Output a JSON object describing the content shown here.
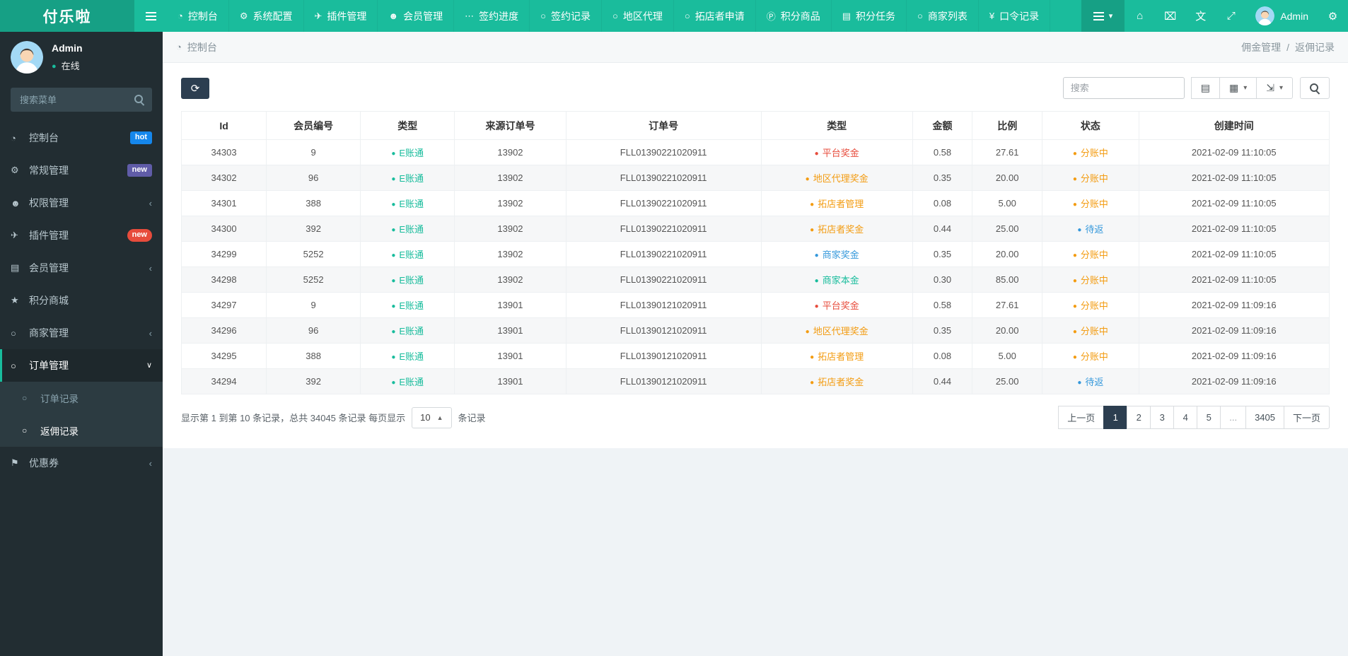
{
  "navbar": {
    "brand": "付乐啦",
    "menu": [
      {
        "label": "控制台",
        "icon": "dashboard-icon",
        "glyph": "◔"
      },
      {
        "label": "系统配置",
        "icon": "gear-icon",
        "glyph": "⚙"
      },
      {
        "label": "插件管理",
        "icon": "paper-plane-icon",
        "glyph": "✈"
      },
      {
        "label": "会员管理",
        "icon": "user-icon",
        "glyph": "☻"
      },
      {
        "label": "签约进度",
        "icon": "ellipsis-icon",
        "glyph": "⋯"
      },
      {
        "label": "签约记录",
        "icon": "circle-o-icon",
        "glyph": "○"
      },
      {
        "label": "地区代理",
        "icon": "circle-o-icon",
        "glyph": "○"
      },
      {
        "label": "拓店者申请",
        "icon": "circle-o-icon",
        "glyph": "○"
      },
      {
        "label": "积分商品",
        "icon": "circled-p-icon",
        "glyph": "Ⓟ"
      },
      {
        "label": "积分任务",
        "icon": "list-icon",
        "glyph": "▤"
      },
      {
        "label": "商家列表",
        "icon": "circle-o-icon",
        "glyph": "○"
      },
      {
        "label": "口令记录",
        "icon": "yen-icon",
        "glyph": "¥"
      }
    ],
    "more_caret": "▾",
    "right_icons": [
      {
        "name": "home-button",
        "icon": "home-icon",
        "glyph": "⌂"
      },
      {
        "name": "clear-cache-button",
        "icon": "trash-icon",
        "glyph": "⌧"
      },
      {
        "name": "language-button",
        "icon": "language-icon",
        "glyph": "文"
      },
      {
        "name": "fullscreen-button",
        "icon": "fullscreen-icon",
        "glyph": "⤢"
      }
    ],
    "user_name": "Admin",
    "settings_glyph": "⚙"
  },
  "sidebar": {
    "user_name": "Admin",
    "user_status": "在线",
    "search_placeholder": "搜索菜单",
    "items": [
      {
        "label": "控制台",
        "icon": "dashboard-icon",
        "glyph": "◔",
        "badge": "hot",
        "badge_color": "#1587ec"
      },
      {
        "label": "常规管理",
        "icon": "cogs-icon",
        "glyph": "⚙",
        "badge": "new",
        "badge_color": "#605ca8"
      },
      {
        "label": "权限管理",
        "icon": "users-icon",
        "glyph": "☻",
        "chevron": "‹"
      },
      {
        "label": "插件管理",
        "icon": "paper-plane-icon",
        "glyph": "✈",
        "badge": "new",
        "badge_color": "#e74c3c",
        "badge_pill": "pill"
      },
      {
        "label": "会员管理",
        "icon": "list-icon",
        "glyph": "▤",
        "chevron": "‹"
      },
      {
        "label": "积分商城",
        "icon": "star-icon",
        "glyph": "★"
      },
      {
        "label": "商家管理",
        "icon": "circle-o-icon",
        "glyph": "○",
        "chevron": "‹"
      },
      {
        "label": "订单管理",
        "icon": "circle-o-icon",
        "glyph": "○",
        "chevron": "∨",
        "cls": "open"
      },
      {
        "label": "订单记录",
        "icon": "circle-o-icon",
        "glyph": "○",
        "cls": "sub"
      },
      {
        "label": "返佣记录",
        "icon": "circle-o-icon",
        "glyph": "○",
        "cls": "sub active"
      },
      {
        "label": "优惠券",
        "icon": "flag-icon",
        "glyph": "⚑",
        "chevron": "‹"
      }
    ]
  },
  "breadcrumb": {
    "location_glyph": "◔",
    "location": "控制台",
    "trail": [
      "佣金管理",
      "返佣记录"
    ],
    "separator": "/"
  },
  "toolbar": {
    "refresh_glyph": "⟳",
    "search_placeholder": "搜索",
    "buttons": [
      {
        "name": "detail-view-button",
        "icon": "detail-view-icon",
        "glyph": "▤"
      },
      {
        "name": "columns-dropdown-button",
        "icon": "columns-icon",
        "glyph": "▦",
        "caret": "▾"
      },
      {
        "name": "export-dropdown-button",
        "icon": "export-icon",
        "glyph": "⇲",
        "caret": "▾"
      }
    ]
  },
  "table": {
    "headers": [
      "Id",
      "会员编号",
      "类型",
      "来源订单号",
      "订单号",
      "类型",
      "金额",
      "比例",
      "状态",
      "创建时间"
    ],
    "rows": [
      {
        "id": "34303",
        "member_no": "9",
        "account_type": "E账通",
        "account_color": "#18bc9c",
        "source_order_no": "13902",
        "order_no": "FLL01390221020911",
        "reward_type": "平台奖金",
        "reward_color": "#e74c3c",
        "amount": "0.58",
        "ratio": "27.61",
        "status": "分账中",
        "status_color": "#f39c12",
        "created_at": "2021-02-09 11:10:05"
      },
      {
        "id": "34302",
        "member_no": "96",
        "account_type": "E账通",
        "account_color": "#18bc9c",
        "source_order_no": "13902",
        "order_no": "FLL01390221020911",
        "reward_type": "地区代理奖金",
        "reward_color": "#f39c12",
        "amount": "0.35",
        "ratio": "20.00",
        "status": "分账中",
        "status_color": "#f39c12",
        "created_at": "2021-02-09 11:10:05"
      },
      {
        "id": "34301",
        "member_no": "388",
        "account_type": "E账通",
        "account_color": "#18bc9c",
        "source_order_no": "13902",
        "order_no": "FLL01390221020911",
        "reward_type": "拓店者管理",
        "reward_color": "#f39c12",
        "amount": "0.08",
        "ratio": "5.00",
        "status": "分账中",
        "status_color": "#f39c12",
        "created_at": "2021-02-09 11:10:05"
      },
      {
        "id": "34300",
        "member_no": "392",
        "account_type": "E账通",
        "account_color": "#18bc9c",
        "source_order_no": "13902",
        "order_no": "FLL01390221020911",
        "reward_type": "拓店者奖金",
        "reward_color": "#f39c12",
        "amount": "0.44",
        "ratio": "25.00",
        "status": "待返",
        "status_color": "#3498db",
        "created_at": "2021-02-09 11:10:05"
      },
      {
        "id": "34299",
        "member_no": "5252",
        "account_type": "E账通",
        "account_color": "#18bc9c",
        "source_order_no": "13902",
        "order_no": "FLL01390221020911",
        "reward_type": "商家奖金",
        "reward_color": "#3498db",
        "amount": "0.35",
        "ratio": "20.00",
        "status": "分账中",
        "status_color": "#f39c12",
        "created_at": "2021-02-09 11:10:05"
      },
      {
        "id": "34298",
        "member_no": "5252",
        "account_type": "E账通",
        "account_color": "#18bc9c",
        "source_order_no": "13902",
        "order_no": "FLL01390221020911",
        "reward_type": "商家本金",
        "reward_color": "#18bc9c",
        "amount": "0.30",
        "ratio": "85.00",
        "status": "分账中",
        "status_color": "#f39c12",
        "created_at": "2021-02-09 11:10:05"
      },
      {
        "id": "34297",
        "member_no": "9",
        "account_type": "E账通",
        "account_color": "#18bc9c",
        "source_order_no": "13901",
        "order_no": "FLL01390121020911",
        "reward_type": "平台奖金",
        "reward_color": "#e74c3c",
        "amount": "0.58",
        "ratio": "27.61",
        "status": "分账中",
        "status_color": "#f39c12",
        "created_at": "2021-02-09 11:09:16"
      },
      {
        "id": "34296",
        "member_no": "96",
        "account_type": "E账通",
        "account_color": "#18bc9c",
        "source_order_no": "13901",
        "order_no": "FLL01390121020911",
        "reward_type": "地区代理奖金",
        "reward_color": "#f39c12",
        "amount": "0.35",
        "ratio": "20.00",
        "status": "分账中",
        "status_color": "#f39c12",
        "created_at": "2021-02-09 11:09:16"
      },
      {
        "id": "34295",
        "member_no": "388",
        "account_type": "E账通",
        "account_color": "#18bc9c",
        "source_order_no": "13901",
        "order_no": "FLL01390121020911",
        "reward_type": "拓店者管理",
        "reward_color": "#f39c12",
        "amount": "0.08",
        "ratio": "5.00",
        "status": "分账中",
        "status_color": "#f39c12",
        "created_at": "2021-02-09 11:09:16"
      },
      {
        "id": "34294",
        "member_no": "392",
        "account_type": "E账通",
        "account_color": "#18bc9c",
        "source_order_no": "13901",
        "order_no": "FLL01390121020911",
        "reward_type": "拓店者奖金",
        "reward_color": "#f39c12",
        "amount": "0.44",
        "ratio": "25.00",
        "status": "待返",
        "status_color": "#3498db",
        "created_at": "2021-02-09 11:09:16"
      }
    ]
  },
  "pagination": {
    "info_prefix": "显示第 1 到第 10 条记录，总共 34045 条记录 每页显示",
    "page_size": "10",
    "page_size_caret": "▲",
    "info_suffix": "条记录",
    "pages": [
      {
        "label": "上一页"
      },
      {
        "label": "1",
        "cls": "active"
      },
      {
        "label": "2"
      },
      {
        "label": "3"
      },
      {
        "label": "4"
      },
      {
        "label": "5"
      },
      {
        "label": "...",
        "cls": "disabled"
      },
      {
        "label": "3405"
      },
      {
        "label": "下一页"
      }
    ]
  },
  "colors": {
    "navbar": "#1abc9c",
    "brand": "#16a085",
    "sidebar": "#222d32",
    "accent": "#18bc9c",
    "primary_button": "#2c3e50",
    "status_orange": "#f39c12",
    "status_blue": "#3498db",
    "status_red": "#e74c3c",
    "status_teal": "#18bc9c"
  }
}
